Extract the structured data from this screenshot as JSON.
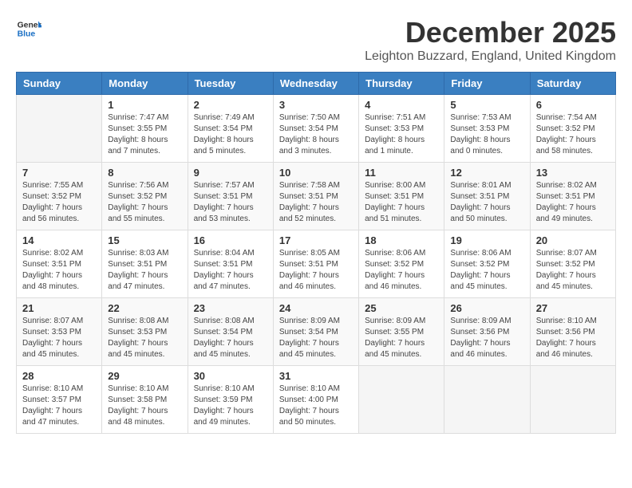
{
  "header": {
    "logo_general": "General",
    "logo_blue": "Blue",
    "month_title": "December 2025",
    "location": "Leighton Buzzard, England, United Kingdom"
  },
  "weekdays": [
    "Sunday",
    "Monday",
    "Tuesday",
    "Wednesday",
    "Thursday",
    "Friday",
    "Saturday"
  ],
  "weeks": [
    [
      {
        "day": "",
        "info": ""
      },
      {
        "day": "1",
        "info": "Sunrise: 7:47 AM\nSunset: 3:55 PM\nDaylight: 8 hours\nand 7 minutes."
      },
      {
        "day": "2",
        "info": "Sunrise: 7:49 AM\nSunset: 3:54 PM\nDaylight: 8 hours\nand 5 minutes."
      },
      {
        "day": "3",
        "info": "Sunrise: 7:50 AM\nSunset: 3:54 PM\nDaylight: 8 hours\nand 3 minutes."
      },
      {
        "day": "4",
        "info": "Sunrise: 7:51 AM\nSunset: 3:53 PM\nDaylight: 8 hours\nand 1 minute."
      },
      {
        "day": "5",
        "info": "Sunrise: 7:53 AM\nSunset: 3:53 PM\nDaylight: 8 hours\nand 0 minutes."
      },
      {
        "day": "6",
        "info": "Sunrise: 7:54 AM\nSunset: 3:52 PM\nDaylight: 7 hours\nand 58 minutes."
      }
    ],
    [
      {
        "day": "7",
        "info": "Sunrise: 7:55 AM\nSunset: 3:52 PM\nDaylight: 7 hours\nand 56 minutes."
      },
      {
        "day": "8",
        "info": "Sunrise: 7:56 AM\nSunset: 3:52 PM\nDaylight: 7 hours\nand 55 minutes."
      },
      {
        "day": "9",
        "info": "Sunrise: 7:57 AM\nSunset: 3:51 PM\nDaylight: 7 hours\nand 53 minutes."
      },
      {
        "day": "10",
        "info": "Sunrise: 7:58 AM\nSunset: 3:51 PM\nDaylight: 7 hours\nand 52 minutes."
      },
      {
        "day": "11",
        "info": "Sunrise: 8:00 AM\nSunset: 3:51 PM\nDaylight: 7 hours\nand 51 minutes."
      },
      {
        "day": "12",
        "info": "Sunrise: 8:01 AM\nSunset: 3:51 PM\nDaylight: 7 hours\nand 50 minutes."
      },
      {
        "day": "13",
        "info": "Sunrise: 8:02 AM\nSunset: 3:51 PM\nDaylight: 7 hours\nand 49 minutes."
      }
    ],
    [
      {
        "day": "14",
        "info": "Sunrise: 8:02 AM\nSunset: 3:51 PM\nDaylight: 7 hours\nand 48 minutes."
      },
      {
        "day": "15",
        "info": "Sunrise: 8:03 AM\nSunset: 3:51 PM\nDaylight: 7 hours\nand 47 minutes."
      },
      {
        "day": "16",
        "info": "Sunrise: 8:04 AM\nSunset: 3:51 PM\nDaylight: 7 hours\nand 47 minutes."
      },
      {
        "day": "17",
        "info": "Sunrise: 8:05 AM\nSunset: 3:51 PM\nDaylight: 7 hours\nand 46 minutes."
      },
      {
        "day": "18",
        "info": "Sunrise: 8:06 AM\nSunset: 3:52 PM\nDaylight: 7 hours\nand 46 minutes."
      },
      {
        "day": "19",
        "info": "Sunrise: 8:06 AM\nSunset: 3:52 PM\nDaylight: 7 hours\nand 45 minutes."
      },
      {
        "day": "20",
        "info": "Sunrise: 8:07 AM\nSunset: 3:52 PM\nDaylight: 7 hours\nand 45 minutes."
      }
    ],
    [
      {
        "day": "21",
        "info": "Sunrise: 8:07 AM\nSunset: 3:53 PM\nDaylight: 7 hours\nand 45 minutes."
      },
      {
        "day": "22",
        "info": "Sunrise: 8:08 AM\nSunset: 3:53 PM\nDaylight: 7 hours\nand 45 minutes."
      },
      {
        "day": "23",
        "info": "Sunrise: 8:08 AM\nSunset: 3:54 PM\nDaylight: 7 hours\nand 45 minutes."
      },
      {
        "day": "24",
        "info": "Sunrise: 8:09 AM\nSunset: 3:54 PM\nDaylight: 7 hours\nand 45 minutes."
      },
      {
        "day": "25",
        "info": "Sunrise: 8:09 AM\nSunset: 3:55 PM\nDaylight: 7 hours\nand 45 minutes."
      },
      {
        "day": "26",
        "info": "Sunrise: 8:09 AM\nSunset: 3:56 PM\nDaylight: 7 hours\nand 46 minutes."
      },
      {
        "day": "27",
        "info": "Sunrise: 8:10 AM\nSunset: 3:56 PM\nDaylight: 7 hours\nand 46 minutes."
      }
    ],
    [
      {
        "day": "28",
        "info": "Sunrise: 8:10 AM\nSunset: 3:57 PM\nDaylight: 7 hours\nand 47 minutes."
      },
      {
        "day": "29",
        "info": "Sunrise: 8:10 AM\nSunset: 3:58 PM\nDaylight: 7 hours\nand 48 minutes."
      },
      {
        "day": "30",
        "info": "Sunrise: 8:10 AM\nSunset: 3:59 PM\nDaylight: 7 hours\nand 49 minutes."
      },
      {
        "day": "31",
        "info": "Sunrise: 8:10 AM\nSunset: 4:00 PM\nDaylight: 7 hours\nand 50 minutes."
      },
      {
        "day": "",
        "info": ""
      },
      {
        "day": "",
        "info": ""
      },
      {
        "day": "",
        "info": ""
      }
    ]
  ]
}
